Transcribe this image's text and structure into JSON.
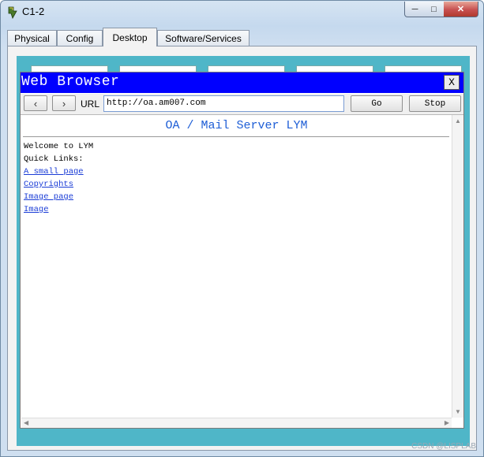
{
  "window": {
    "title": "C1-2",
    "controls": {
      "minimize": "─",
      "maximize": "□",
      "close": "✕"
    }
  },
  "tabs": [
    {
      "label": "Physical"
    },
    {
      "label": "Config"
    },
    {
      "label": "Desktop",
      "active": true
    },
    {
      "label": "Software/Services"
    }
  ],
  "browser": {
    "title": "Web Browser",
    "close_label": "X",
    "back_label": "‹",
    "forward_label": "›",
    "url_label": "URL",
    "url_value": "http://oa.am007.com",
    "go_label": "Go",
    "stop_label": "Stop"
  },
  "page": {
    "heading": "OA / Mail Server LYM",
    "welcome": "Welcome to LYM",
    "quick_links_label": "Quick Links:",
    "links": [
      "A small page",
      "Copyrights",
      "Image page",
      "Image"
    ]
  },
  "watermark": "CSDN @LISPLAB",
  "colors": {
    "browser_header": "#0000ff",
    "desktop_bg": "#4fb6c8",
    "link": "#1a3cd6"
  }
}
